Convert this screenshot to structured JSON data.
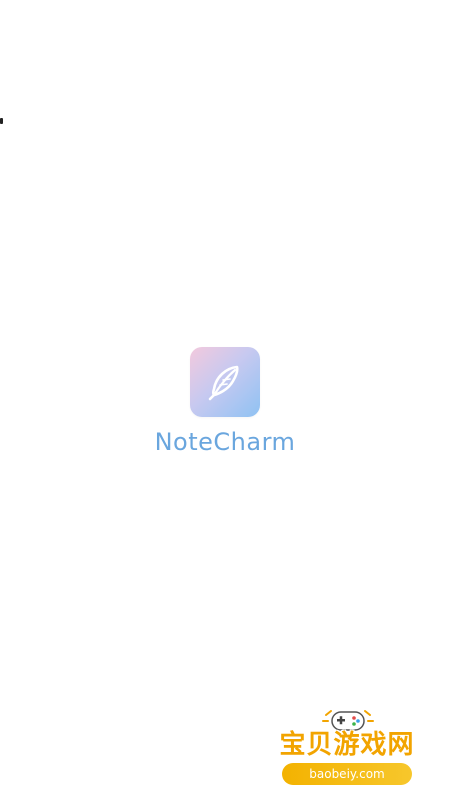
{
  "app": {
    "name": "NoteCharm",
    "icon": "feather-icon"
  },
  "watermark": {
    "title": "宝贝游戏网",
    "url": "baobeiy.com",
    "icon": "gamepad-icon"
  },
  "colors": {
    "background": "#ffffff",
    "brand_text": "#6aa6de",
    "icon_gradient": [
      "#f3c9dd",
      "#c7c9f0",
      "#8fc2f3"
    ],
    "watermark_accent": "#f2a400"
  }
}
